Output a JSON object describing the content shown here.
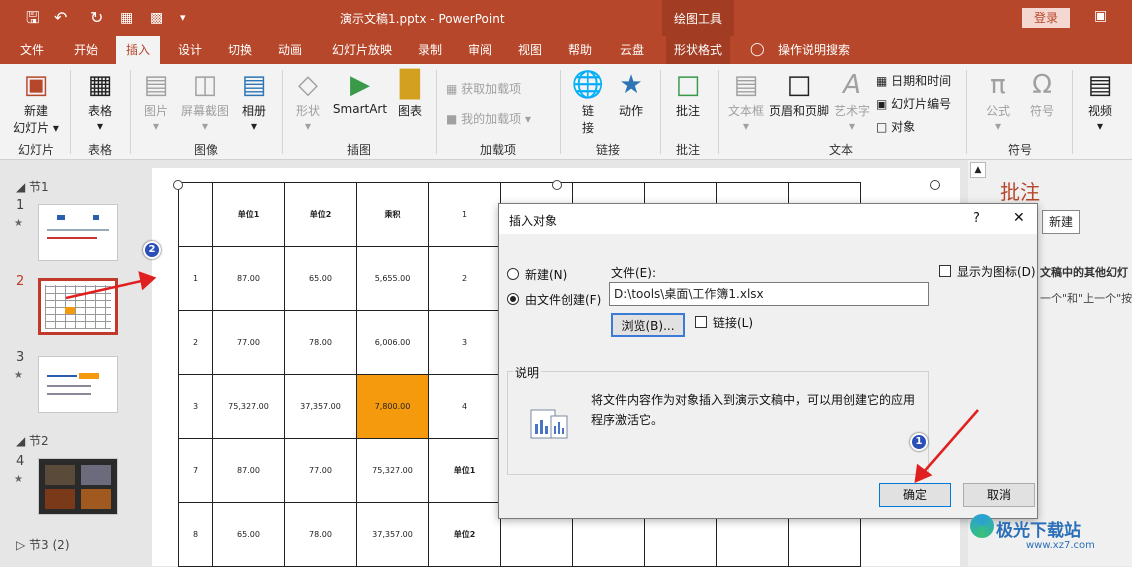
{
  "titlebar": {
    "title": "演示文稿1.pptx - PowerPoint",
    "context_tab": "绘图工具",
    "login": "登录",
    "undo_icon": "undo-icon",
    "save_icon": "save-icon"
  },
  "tabs": [
    {
      "label": "文件"
    },
    {
      "label": "开始"
    },
    {
      "label": "插入"
    },
    {
      "label": "设计"
    },
    {
      "label": "切换"
    },
    {
      "label": "动画"
    },
    {
      "label": "幻灯片放映"
    },
    {
      "label": "录制"
    },
    {
      "label": "审阅"
    },
    {
      "label": "视图"
    },
    {
      "label": "帮助"
    },
    {
      "label": "云盘"
    },
    {
      "label": "形状格式"
    },
    {
      "label": "操作说明搜索"
    }
  ],
  "ribbon": {
    "new_slide": "新建",
    "new_slide2": "幻灯片",
    "table": "表格",
    "picture": "图片",
    "screenshot": "屏幕截图",
    "album": "相册",
    "shape": "形状",
    "smartart": "SmartArt",
    "chart": "图表",
    "get_addins": "获取加载项",
    "my_addins": "我的加载项",
    "link": "链",
    "link2": "接",
    "action": "动作",
    "comment": "批注",
    "textbox": "文本框",
    "header_footer": "页眉和页脚",
    "wordart": "艺术字",
    "datetime": "日期和时间",
    "slide_number": "幻灯片编号",
    "object": "对象",
    "formula": "公式",
    "symbol": "符号",
    "video": "视频",
    "groups": {
      "slides": "幻灯片",
      "tables": "表格",
      "images": "图像",
      "illustrations": "插图",
      "addins": "加载项",
      "links": "链接",
      "comments": "批注",
      "text": "文本",
      "symbols": "符号"
    }
  },
  "thumbs": {
    "section1": "节1",
    "section2": "节2",
    "section3": "节3 (2)",
    "slides": [
      {
        "num": "1"
      },
      {
        "num": "2"
      },
      {
        "num": "3"
      },
      {
        "num": "4"
      }
    ]
  },
  "table": {
    "header": [
      "",
      "单位1",
      "单位2",
      "乘积",
      "1"
    ],
    "rows": [
      [
        "1",
        "87.00",
        "65.00",
        "5,655.00",
        "2"
      ],
      [
        "2",
        "77.00",
        "78.00",
        "6,006.00",
        "3"
      ],
      [
        "3",
        "75,327.00",
        "37,357.00",
        "7,800.00",
        "4"
      ],
      [
        "7",
        "87.00",
        "77.00",
        "75,327.00",
        "单位1"
      ],
      [
        "8",
        "65.00",
        "78.00",
        "37,357.00",
        "单位2"
      ]
    ],
    "highlight_color": "#f59a0c"
  },
  "notes": {
    "title": "批注",
    "new_button": "新建",
    "line1": "文稿中的其他幻灯",
    "line2": "一个\"和\"上一个\"按"
  },
  "dialog": {
    "title": "插入对象",
    "help": "?",
    "close": "✕",
    "option_new": "新建(N)",
    "option_from_file": "由文件创建(F)",
    "file_label": "文件(E):",
    "file_value": "D:\\tools\\桌面\\工作簿1.xlsx",
    "browse": "浏览(B)...",
    "link": "链接(L)",
    "display_as_icon": "显示为图标(D)",
    "description_title": "说明",
    "description": "将文件内容作为对象插入到演示文稿中，可以用创建它的应用程序激活它。",
    "ok": "确定",
    "cancel": "取消"
  },
  "annotations": {
    "marker1": "1",
    "marker2": "2",
    "arrow_color": "#e02020"
  },
  "watermark": {
    "text": "极光下载站",
    "url": "www.xz7.com"
  }
}
